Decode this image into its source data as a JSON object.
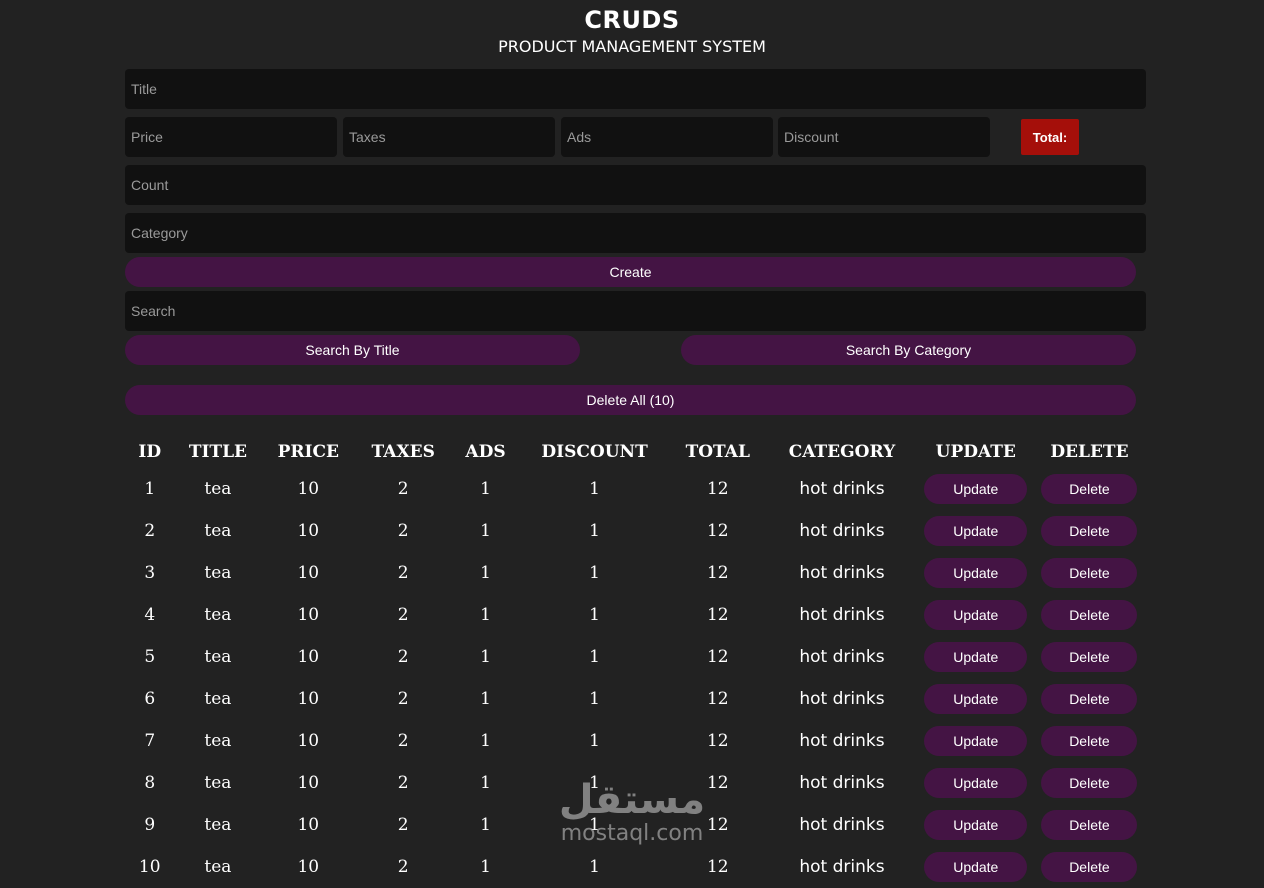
{
  "header": {
    "title": "CRUDS",
    "subtitle": "PRODUCT MANAGEMENT SYSTEM"
  },
  "form": {
    "title_placeholder": "Title",
    "price_placeholder": "Price",
    "taxes_placeholder": "Taxes",
    "ads_placeholder": "Ads",
    "discount_placeholder": "Discount",
    "total_label": "Total:",
    "count_placeholder": "Count",
    "category_placeholder": "Category",
    "create_label": "Create"
  },
  "search": {
    "placeholder": "Search",
    "by_title_label": "Search By Title",
    "by_category_label": "Search By Category",
    "delete_all_label": "Delete All (10)"
  },
  "table": {
    "headers": [
      "ID",
      "TITLE",
      "PRICE",
      "TAXES",
      "ADS",
      "DISCOUNT",
      "TOTAL",
      "CATEGORY",
      "UPDATE",
      "DELETE"
    ],
    "update_label": "Update",
    "delete_label": "Delete",
    "rows": [
      {
        "id": "1",
        "title": "tea",
        "price": "10",
        "taxes": "2",
        "ads": "1",
        "discount": "1",
        "total": "12",
        "category": "hot drinks"
      },
      {
        "id": "2",
        "title": "tea",
        "price": "10",
        "taxes": "2",
        "ads": "1",
        "discount": "1",
        "total": "12",
        "category": "hot drinks"
      },
      {
        "id": "3",
        "title": "tea",
        "price": "10",
        "taxes": "2",
        "ads": "1",
        "discount": "1",
        "total": "12",
        "category": "hot drinks"
      },
      {
        "id": "4",
        "title": "tea",
        "price": "10",
        "taxes": "2",
        "ads": "1",
        "discount": "1",
        "total": "12",
        "category": "hot drinks"
      },
      {
        "id": "5",
        "title": "tea",
        "price": "10",
        "taxes": "2",
        "ads": "1",
        "discount": "1",
        "total": "12",
        "category": "hot drinks"
      },
      {
        "id": "6",
        "title": "tea",
        "price": "10",
        "taxes": "2",
        "ads": "1",
        "discount": "1",
        "total": "12",
        "category": "hot drinks"
      },
      {
        "id": "7",
        "title": "tea",
        "price": "10",
        "taxes": "2",
        "ads": "1",
        "discount": "1",
        "total": "12",
        "category": "hot drinks"
      },
      {
        "id": "8",
        "title": "tea",
        "price": "10",
        "taxes": "2",
        "ads": "1",
        "discount": "1",
        "total": "12",
        "category": "hot drinks"
      },
      {
        "id": "9",
        "title": "tea",
        "price": "10",
        "taxes": "2",
        "ads": "1",
        "discount": "1",
        "total": "12",
        "category": "hot drinks"
      },
      {
        "id": "10",
        "title": "tea",
        "price": "10",
        "taxes": "2",
        "ads": "1",
        "discount": "1",
        "total": "12",
        "category": "hot drinks"
      }
    ]
  },
  "watermark": {
    "arabic": "مستقل",
    "latin": "mostaql.com"
  },
  "colors": {
    "background": "#222222",
    "input": "#111111",
    "button": "#441444",
    "total": "#a50f0a"
  }
}
